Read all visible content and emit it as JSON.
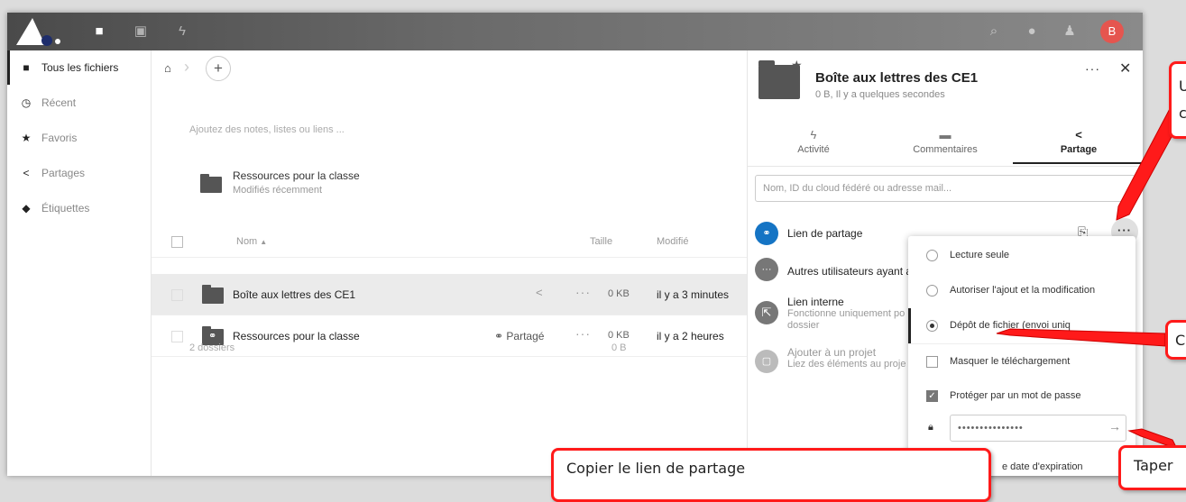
{
  "header": {
    "icons": [
      "files-icon",
      "photos-icon",
      "activity-icon",
      "search-icon",
      "notifications-icon",
      "contacts-icon"
    ],
    "avatar_initial": "B",
    "avatar_color": "#e5554f"
  },
  "sidebar": {
    "items": [
      {
        "label": "Tous les fichiers",
        "icon": "folder-icon",
        "active": true
      },
      {
        "label": "Récent",
        "icon": "clock-icon"
      },
      {
        "label": "Favoris",
        "icon": "star-icon"
      },
      {
        "label": "Partages",
        "icon": "share-icon"
      },
      {
        "label": "Étiquettes",
        "icon": "tag-icon"
      }
    ]
  },
  "main": {
    "add_label": "+",
    "notes_placeholder": "Ajoutez des notes, listes ou liens ...",
    "recent": {
      "name": "Ressources pour la classe",
      "subtitle": "Modifiés récemment"
    },
    "columns": {
      "name": "Nom",
      "size": "Taille",
      "modified": "Modifié"
    },
    "rows": [
      {
        "name": "Boîte aux lettres des CE1",
        "size": "0 KB",
        "modified": "il y a 3 minutes",
        "selected": true,
        "shared_label": ""
      },
      {
        "name": "Ressources pour la classe",
        "size": "0 KB",
        "modified": "il y a 2 heures",
        "selected": false,
        "shared_label": "Partagé"
      }
    ],
    "footer": {
      "count": "2 dossiers",
      "size": "0 B"
    }
  },
  "panel": {
    "title": "Boîte aux lettres des CE1",
    "subtitle": "0 B, Il y a quelques secondes",
    "tabs": [
      {
        "label": "Activité",
        "icon": "activity-icon"
      },
      {
        "label": "Commentaires",
        "icon": "comment-icon"
      },
      {
        "label": "Partage",
        "icon": "share-icon",
        "active": true
      }
    ],
    "share_placeholder": "Nom, ID du cloud fédéré ou adresse mail...",
    "share_link_label": "Lien de partage",
    "other_users": "Autres utilisateurs ayant ac",
    "internal_link": {
      "title": "Lien interne",
      "line1": "Fonctionne uniquement po",
      "line2": "dossier"
    },
    "project": {
      "title": "Ajouter à un projet",
      "subtitle": "Liez des éléments au proje"
    }
  },
  "menu": {
    "items": [
      {
        "label": "Lecture seule",
        "type": "radio",
        "checked": false
      },
      {
        "label": "Autoriser l'ajout et la modification",
        "type": "radio",
        "checked": false
      },
      {
        "label": "Dépôt de fichier (envoi uniq",
        "type": "radio",
        "checked": true
      },
      {
        "label": "Masquer le téléchargement",
        "type": "checkbox",
        "checked": false
      },
      {
        "label": "Protéger par un mot de passe",
        "type": "checkbox",
        "checked": true
      }
    ],
    "password_value": "•••••••••••••••",
    "expire_label": "e date d'expiration"
  },
  "callouts": {
    "copy": "Copier le lien de partage",
    "click_1": "Un",
    "click_2": "cli",
    "choose": "Ch",
    "type": "Taper"
  },
  "colors": {
    "callout_border": "#ff1a1a",
    "link_blue": "#1574c4"
  }
}
